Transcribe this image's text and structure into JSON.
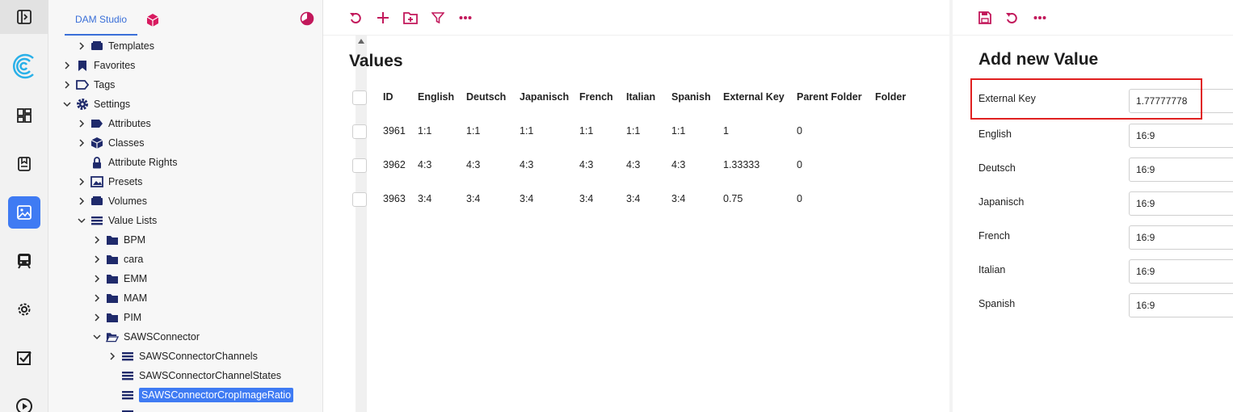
{
  "tree": {
    "tab_label": "DAM Studio",
    "items": [
      {
        "label": "Templates"
      },
      {
        "label": "Favorites"
      },
      {
        "label": "Tags"
      },
      {
        "label": "Settings"
      },
      {
        "label": "Attributes"
      },
      {
        "label": "Classes"
      },
      {
        "label": "Attribute Rights"
      },
      {
        "label": "Presets"
      },
      {
        "label": "Volumes"
      },
      {
        "label": "Value Lists"
      },
      {
        "label": "BPM"
      },
      {
        "label": "cara"
      },
      {
        "label": "EMM"
      },
      {
        "label": "MAM"
      },
      {
        "label": "PIM"
      },
      {
        "label": "SAWSConnector"
      },
      {
        "label": "SAWSConnectorChannels"
      },
      {
        "label": "SAWSConnectorChannelStates"
      },
      {
        "label": "SAWSConnectorCropImageRatio"
      }
    ]
  },
  "values": {
    "title": "Values",
    "columns": [
      "ID",
      "English",
      "Deutsch",
      "Japanisch",
      "French",
      "Italian",
      "Spanish",
      "External Key",
      "Parent Folder",
      "Folder"
    ],
    "rows": [
      [
        "3961",
        "1:1",
        "1:1",
        "1:1",
        "1:1",
        "1:1",
        "1:1",
        "1",
        "0",
        ""
      ],
      [
        "3962",
        "4:3",
        "4:3",
        "4:3",
        "4:3",
        "4:3",
        "4:3",
        "1.33333",
        "0",
        ""
      ],
      [
        "3963",
        "3:4",
        "3:4",
        "3:4",
        "3:4",
        "3:4",
        "3:4",
        "0.75",
        "0",
        ""
      ]
    ]
  },
  "form": {
    "title": "Add new Value",
    "fields": [
      {
        "label": "External Key",
        "value": "1.77777778"
      },
      {
        "label": "English",
        "value": "16:9"
      },
      {
        "label": "Deutsch",
        "value": "16:9"
      },
      {
        "label": "Japanisch",
        "value": "16:9"
      },
      {
        "label": "French",
        "value": "16:9"
      },
      {
        "label": "Italian",
        "value": "16:9"
      },
      {
        "label": "Spanish",
        "value": "16:9"
      }
    ]
  },
  "colors": {
    "accent": "#c2185b",
    "nav": "#1f2a6b",
    "selection": "#3f7bf3"
  }
}
